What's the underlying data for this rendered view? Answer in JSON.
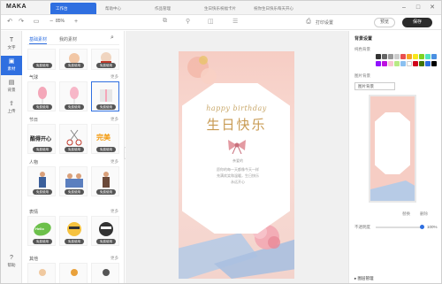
{
  "app": {
    "logo": "MAKA"
  },
  "tabs": [
    {
      "label": "工作台",
      "active": true
    },
    {
      "label": "帮助中心",
      "active": false
    },
    {
      "label": "作品管理",
      "active": false
    },
    {
      "label": "生日快乐祝福卡片",
      "active": false
    },
    {
      "label": "祝你生日快乐每天开心",
      "active": false
    }
  ],
  "toolbar": {
    "zoom": "85%",
    "print_label": "打印设置",
    "preview": "预览",
    "save": "保存"
  },
  "rail": [
    {
      "icon": "T",
      "label": "文字"
    },
    {
      "icon": "▣",
      "label": "素材"
    },
    {
      "icon": "▤",
      "label": "背景"
    },
    {
      "icon": "⇪",
      "label": "上传"
    },
    {
      "icon": "?",
      "label": "帮助"
    }
  ],
  "panel": {
    "tabs": [
      "基础素材",
      "我的素材"
    ],
    "sections": [
      {
        "title": "热门"
      },
      {
        "title": "气球"
      },
      {
        "title": "节日"
      },
      {
        "title": "人物"
      },
      {
        "title": "表情"
      },
      {
        "title": "其他"
      }
    ],
    "more": "更多",
    "thumb_label": "免费使用",
    "sticker_text": "酷得开心",
    "sticker_text2": "完美",
    "sticker_badge": "Hello"
  },
  "poster": {
    "hb": "happy birthday",
    "title": "生日快乐",
    "small1": "亲爱的",
    "lines": [
      "愿你的每一天都像今天一样",
      "充满欢笑和温暖，生日快乐",
      "永远开心"
    ]
  },
  "right": {
    "title": "背景设置",
    "color_label": "纯色背景",
    "bg_label": "图片背景",
    "select_value": "图片背景",
    "link_label1": "替换",
    "link_label2": "删除",
    "opacity_label": "不透明度",
    "opacity_value": "100%",
    "footer": "▸ 图层管理",
    "swatches": [
      "#333333",
      "#666666",
      "#999999",
      "#cccccc",
      "#e94f4f",
      "#f5a623",
      "#f8e71c",
      "#7ed321",
      "#50e3c2",
      "#4a90e2",
      "#9013fe",
      "#bd10e0",
      "#f7c5d2",
      "#b8e986",
      "#8bc0f0",
      "#ffffff",
      "#d0021b",
      "#417505",
      "#2f6fe0",
      "#000000"
    ]
  }
}
